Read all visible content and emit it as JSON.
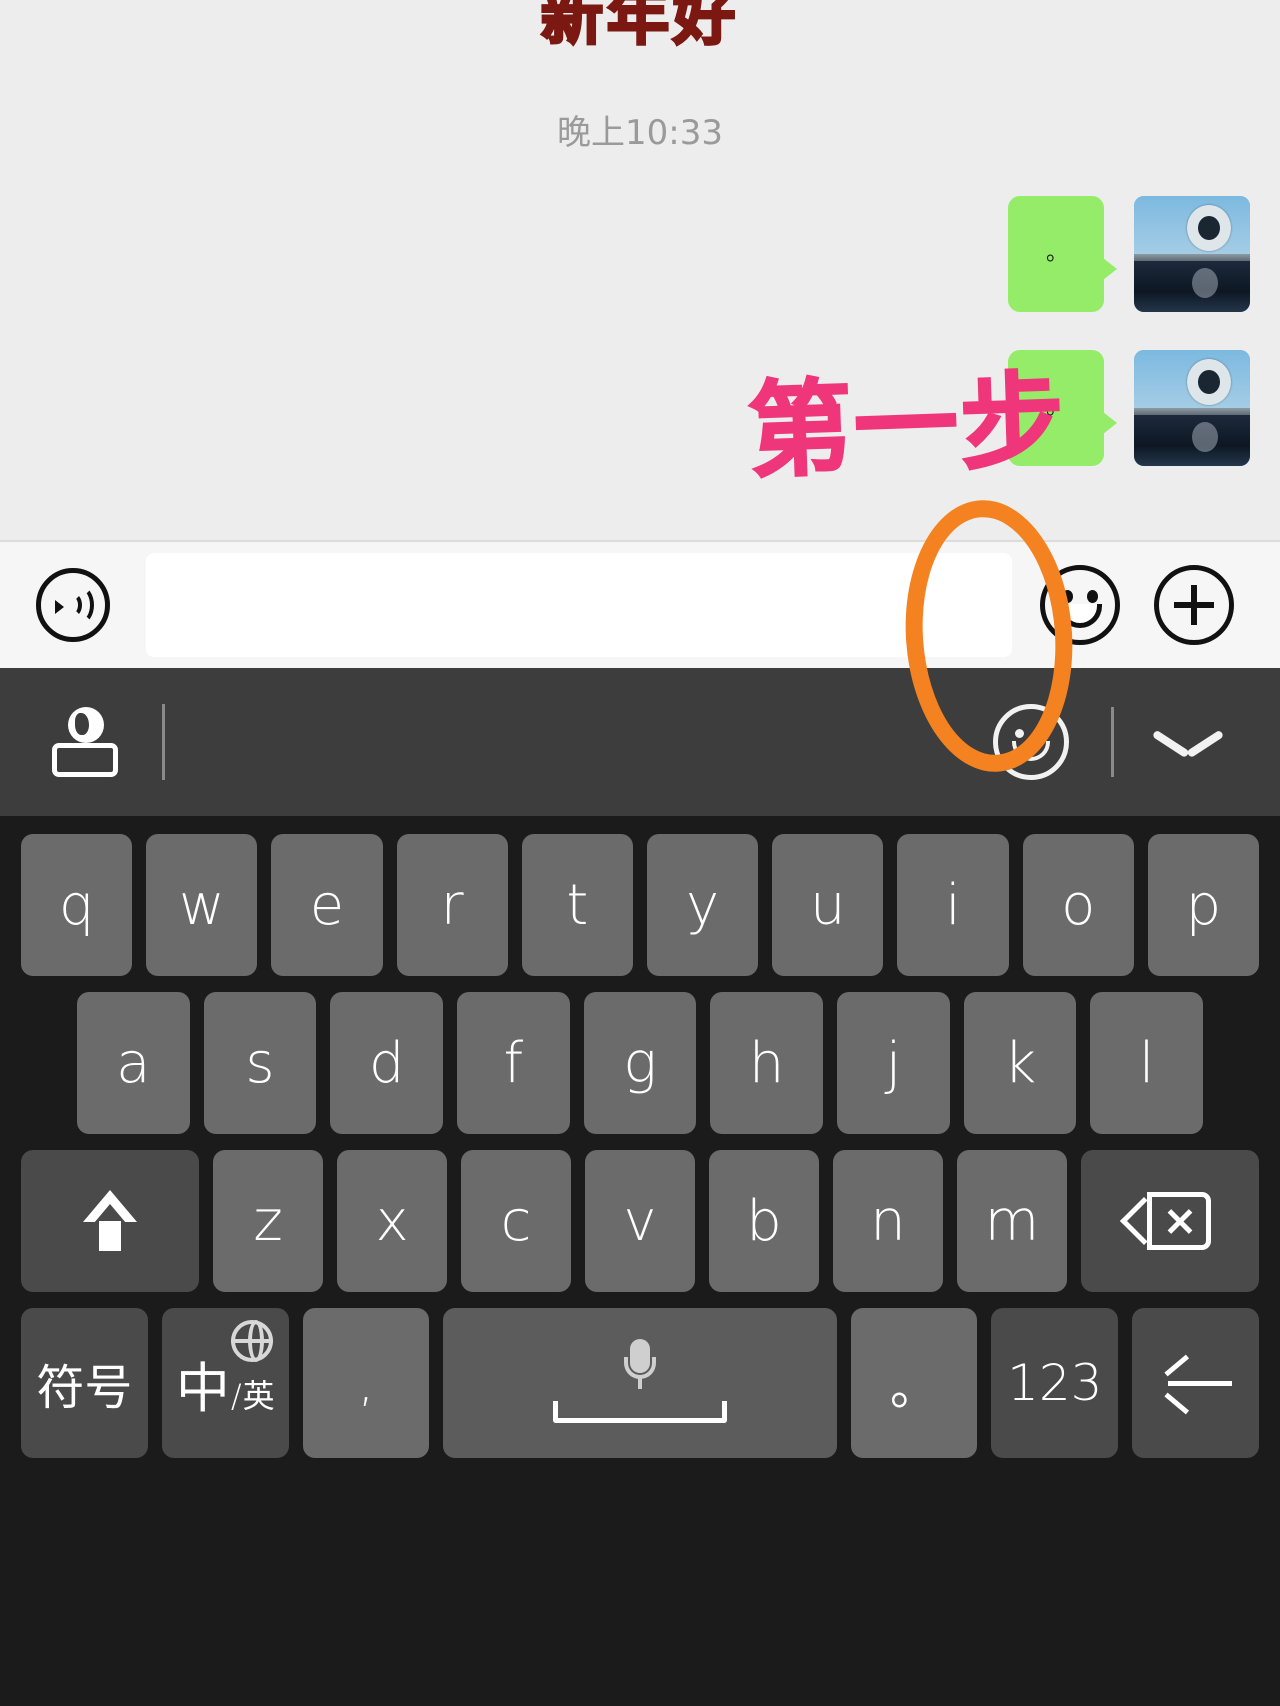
{
  "app": "wechat-chat",
  "chat": {
    "sticker_text": "新年好",
    "timestamp": "晚上10:33",
    "messages": [
      {
        "bubble_text": "。",
        "avatar_name": "contact-avatar",
        "side": "right"
      },
      {
        "bubble_text": "。",
        "avatar_name": "contact-avatar",
        "side": "right"
      }
    ],
    "annotation": "第一步",
    "annotation_color": "#f0367a",
    "bubble_color": "#95ec69",
    "background_color": "#ededed"
  },
  "input_bar": {
    "voice_icon": "voice-wave-icon",
    "text_value": "",
    "text_placeholder": "",
    "emoji_icon": "smiley-face-icon",
    "plus_icon": "plus-circle-icon",
    "highlight_color": "#f58220",
    "highlight_target": "emoji-button"
  },
  "keyboard_toolbar": {
    "globe_keyboard_icon": "globe-keyboard-icon",
    "smiley_icon": "smiley-outline-icon",
    "collapse_icon": "chevron-down-icon",
    "background_color": "#3d3d3d"
  },
  "keyboard": {
    "background_color": "#1b1b1b",
    "key_color": "#6b6b6b",
    "special_key_color": "#4a4a4a",
    "rows": [
      {
        "name": "row-qwerty",
        "keys": [
          {
            "label": "q"
          },
          {
            "label": "w"
          },
          {
            "label": "e"
          },
          {
            "label": "r"
          },
          {
            "label": "t"
          },
          {
            "label": "y"
          },
          {
            "label": "u"
          },
          {
            "label": "i"
          },
          {
            "label": "o"
          },
          {
            "label": "p"
          }
        ]
      },
      {
        "name": "row-asdf",
        "keys": [
          {
            "label": "a"
          },
          {
            "label": "s"
          },
          {
            "label": "d"
          },
          {
            "label": "f"
          },
          {
            "label": "g"
          },
          {
            "label": "h"
          },
          {
            "label": "j"
          },
          {
            "label": "k"
          },
          {
            "label": "l"
          }
        ]
      },
      {
        "name": "row-zxcv",
        "keys": [
          {
            "label": "",
            "icon": "shift-icon"
          },
          {
            "label": "z"
          },
          {
            "label": "x"
          },
          {
            "label": "c"
          },
          {
            "label": "v"
          },
          {
            "label": "b"
          },
          {
            "label": "n"
          },
          {
            "label": "m"
          },
          {
            "label": "",
            "icon": "backspace-icon"
          }
        ]
      },
      {
        "name": "row-bottom",
        "keys": [
          {
            "label": "符号"
          },
          {
            "label": "中",
            "sub": "英",
            "icon": "globe-icon"
          },
          {
            "label": ","
          },
          {
            "label": "",
            "icon": "microphone-icon"
          },
          {
            "label": "。"
          },
          {
            "label": "123"
          },
          {
            "label": "",
            "icon": "enter-icon"
          }
        ]
      }
    ]
  }
}
